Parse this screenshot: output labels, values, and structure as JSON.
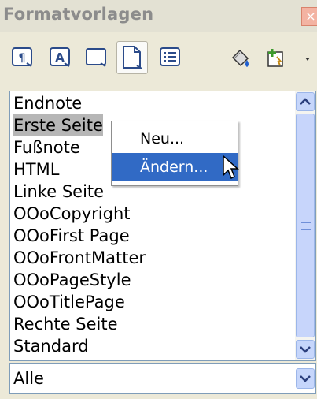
{
  "window": {
    "title": "Formatvorlagen",
    "close_glyph": "×"
  },
  "toolbar": {
    "buttons": [
      {
        "icon": "paragraph-styles-icon"
      },
      {
        "icon": "character-styles-icon"
      },
      {
        "icon": "frame-styles-icon"
      },
      {
        "icon": "page-styles-icon",
        "active": true
      },
      {
        "icon": "list-styles-icon"
      },
      {
        "icon": "fill-format-mode-icon"
      },
      {
        "icon": "new-style-from-selection-icon"
      }
    ]
  },
  "list": {
    "items": [
      {
        "label": "Endnote"
      },
      {
        "label": "Erste Seite",
        "selected": true
      },
      {
        "label": "Fußnote"
      },
      {
        "label": "HTML"
      },
      {
        "label": "Linke Seite"
      },
      {
        "label": "OOoCopyright"
      },
      {
        "label": "OOoFirst Page"
      },
      {
        "label": "OOoFrontMatter"
      },
      {
        "label": "OOoPageStyle"
      },
      {
        "label": "OOoTitlePage"
      },
      {
        "label": "Rechte Seite"
      },
      {
        "label": "Standard"
      }
    ]
  },
  "context_menu": {
    "items": [
      {
        "label": "Neu..."
      },
      {
        "label": "Ändern...",
        "highlighted": true
      }
    ]
  },
  "filter": {
    "value": "Alle"
  },
  "colors": {
    "highlight": "#316ac5",
    "selection": "#b6b6b6",
    "scroll": "#c6d6fb"
  }
}
